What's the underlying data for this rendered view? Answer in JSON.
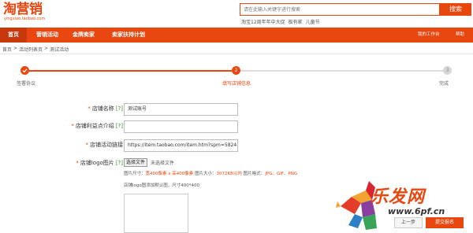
{
  "header": {
    "logo_text": "淘营销",
    "logo_url": "yingxiao.taobao.com",
    "search_placeholder": "请在此输入关键字进行搜索",
    "search_button": "搜索",
    "hot_words": [
      "淘宝12周年年中大促",
      "极有家",
      "儿童节"
    ]
  },
  "nav": {
    "items": [
      "首页",
      "营销活动",
      "金牌卖家",
      "卖家扶持计划"
    ],
    "active_index": 0,
    "right_items": [
      "我的工作台",
      "帮助"
    ]
  },
  "breadcrumb": [
    "首页",
    ">",
    "活动列表页",
    ">",
    "测试活动"
  ],
  "steps": [
    {
      "number": "",
      "label": "签署协议",
      "state": "done"
    },
    {
      "number": "2",
      "label": "填写店铺信息",
      "state": "current"
    },
    {
      "number": "3",
      "label": "完成",
      "state": "todo"
    }
  ],
  "form": {
    "star": "*",
    "help": "[?]",
    "store_name_label": "店铺名称",
    "store_name_value": "测试账号",
    "store_point_label": "店铺利益点介绍",
    "store_point_value": "",
    "store_link_label": "店铺活动链接",
    "store_link_value": "https://item.taobao.com/item.htm?spm=5824.7",
    "store_logo_label": "店铺logo图片",
    "file_button": "选择文件",
    "file_none": "未选择文件",
    "spec_size_label": "图片尺寸：",
    "spec_size_value": "宽400像素 x 高400像素",
    "spec_weight_label": "图片大小：",
    "spec_weight_value": "3072KB以内",
    "spec_format_label": "图片格式：",
    "spec_format_value": "JPG、GIF、PNG",
    "tip": "店铺logo图添加默认图，尺寸400*400"
  },
  "buttons": {
    "prev": "上一步",
    "next": "提交报名"
  },
  "watermark": {
    "text": "乐发网",
    "url": "www.6pf.cn"
  },
  "colors": {
    "brand": "#e8470f",
    "brand_dark": "#c8380a",
    "help_green": "#3a8f3a"
  }
}
